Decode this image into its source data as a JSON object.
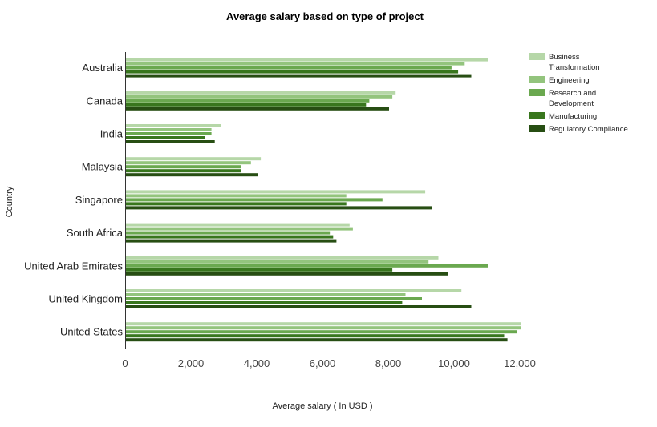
{
  "chart_data": {
    "type": "bar",
    "orientation": "horizontal",
    "title": "Average salary based on type of project",
    "xlabel": "Average salary ( In USD )",
    "ylabel": "Country",
    "xlim": [
      0,
      12000
    ],
    "xticks": [
      0,
      2000,
      4000,
      6000,
      8000,
      10000,
      12000
    ],
    "xtick_labels": [
      "0",
      "2,000",
      "4,000",
      "6,000",
      "8,000",
      "10,000",
      "12,000"
    ],
    "grid": false,
    "legend_position": "top-right",
    "categories": [
      "Australia",
      "Canada",
      "India",
      "Malaysia",
      "Singapore",
      "South Africa",
      "United Arab Emirates",
      "United Kingdom",
      "United States"
    ],
    "series": [
      {
        "name": "Business Transformation",
        "legend_lines": [
          "Business",
          "Transformation"
        ],
        "color": "#b6d7a8",
        "values": [
          11000,
          8200,
          2900,
          4100,
          9100,
          6800,
          9500,
          10200,
          12000
        ]
      },
      {
        "name": "Engineering",
        "legend_lines": [
          "Engineering"
        ],
        "color": "#93c47d",
        "values": [
          10300,
          8100,
          2600,
          3800,
          6700,
          6900,
          9200,
          8500,
          12000
        ]
      },
      {
        "name": "Research and Development",
        "legend_lines": [
          "Research and",
          "Development"
        ],
        "color": "#6aa84f",
        "values": [
          9900,
          7400,
          2600,
          3500,
          7800,
          6200,
          11000,
          9000,
          11900
        ]
      },
      {
        "name": "Manufacturing",
        "legend_lines": [
          "Manufacturing"
        ],
        "color": "#38761d",
        "values": [
          10100,
          7300,
          2400,
          3500,
          6700,
          6300,
          8100,
          8400,
          11500
        ]
      },
      {
        "name": "Regulatory Compliance",
        "legend_lines": [
          "Regulatory Compliance"
        ],
        "color": "#274e13",
        "values": [
          10500,
          8000,
          2700,
          4000,
          9300,
          6400,
          9800,
          10500,
          11600
        ]
      }
    ]
  }
}
